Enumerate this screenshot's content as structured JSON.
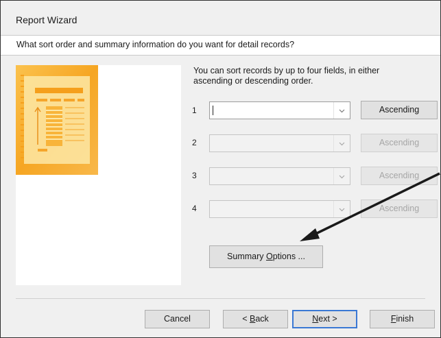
{
  "window": {
    "title": "Report Wizard"
  },
  "header": {
    "question": "What sort order and summary information do you want for detail records?"
  },
  "instructions": "You can sort records by up to four fields, in either ascending or descending order.",
  "sort_rows": [
    {
      "number": "1",
      "field_value": "",
      "order_label": "Ascending",
      "enabled": true
    },
    {
      "number": "2",
      "field_value": "",
      "order_label": "Ascending",
      "enabled": false
    },
    {
      "number": "3",
      "field_value": "",
      "order_label": "Ascending",
      "enabled": false
    },
    {
      "number": "4",
      "field_value": "",
      "order_label": "Ascending",
      "enabled": false
    }
  ],
  "summary_button": {
    "label_pre": "Summary ",
    "label_accel": "O",
    "label_post": "ptions ..."
  },
  "footer": {
    "cancel": "Cancel",
    "back": {
      "pre": "< ",
      "accel": "B",
      "post": "ack"
    },
    "next": {
      "accel": "N",
      "post": "ext >"
    },
    "finish": {
      "accel": "F",
      "post": "inish"
    }
  },
  "icons": {
    "dropdown": "chevron-down-icon",
    "preview": "report-preview-icon",
    "annotation": "annotation-arrow-icon"
  },
  "colors": {
    "accent": "#3a78d4",
    "preview_orange": "#f6a623",
    "disabled_text": "#a6a6a6"
  }
}
